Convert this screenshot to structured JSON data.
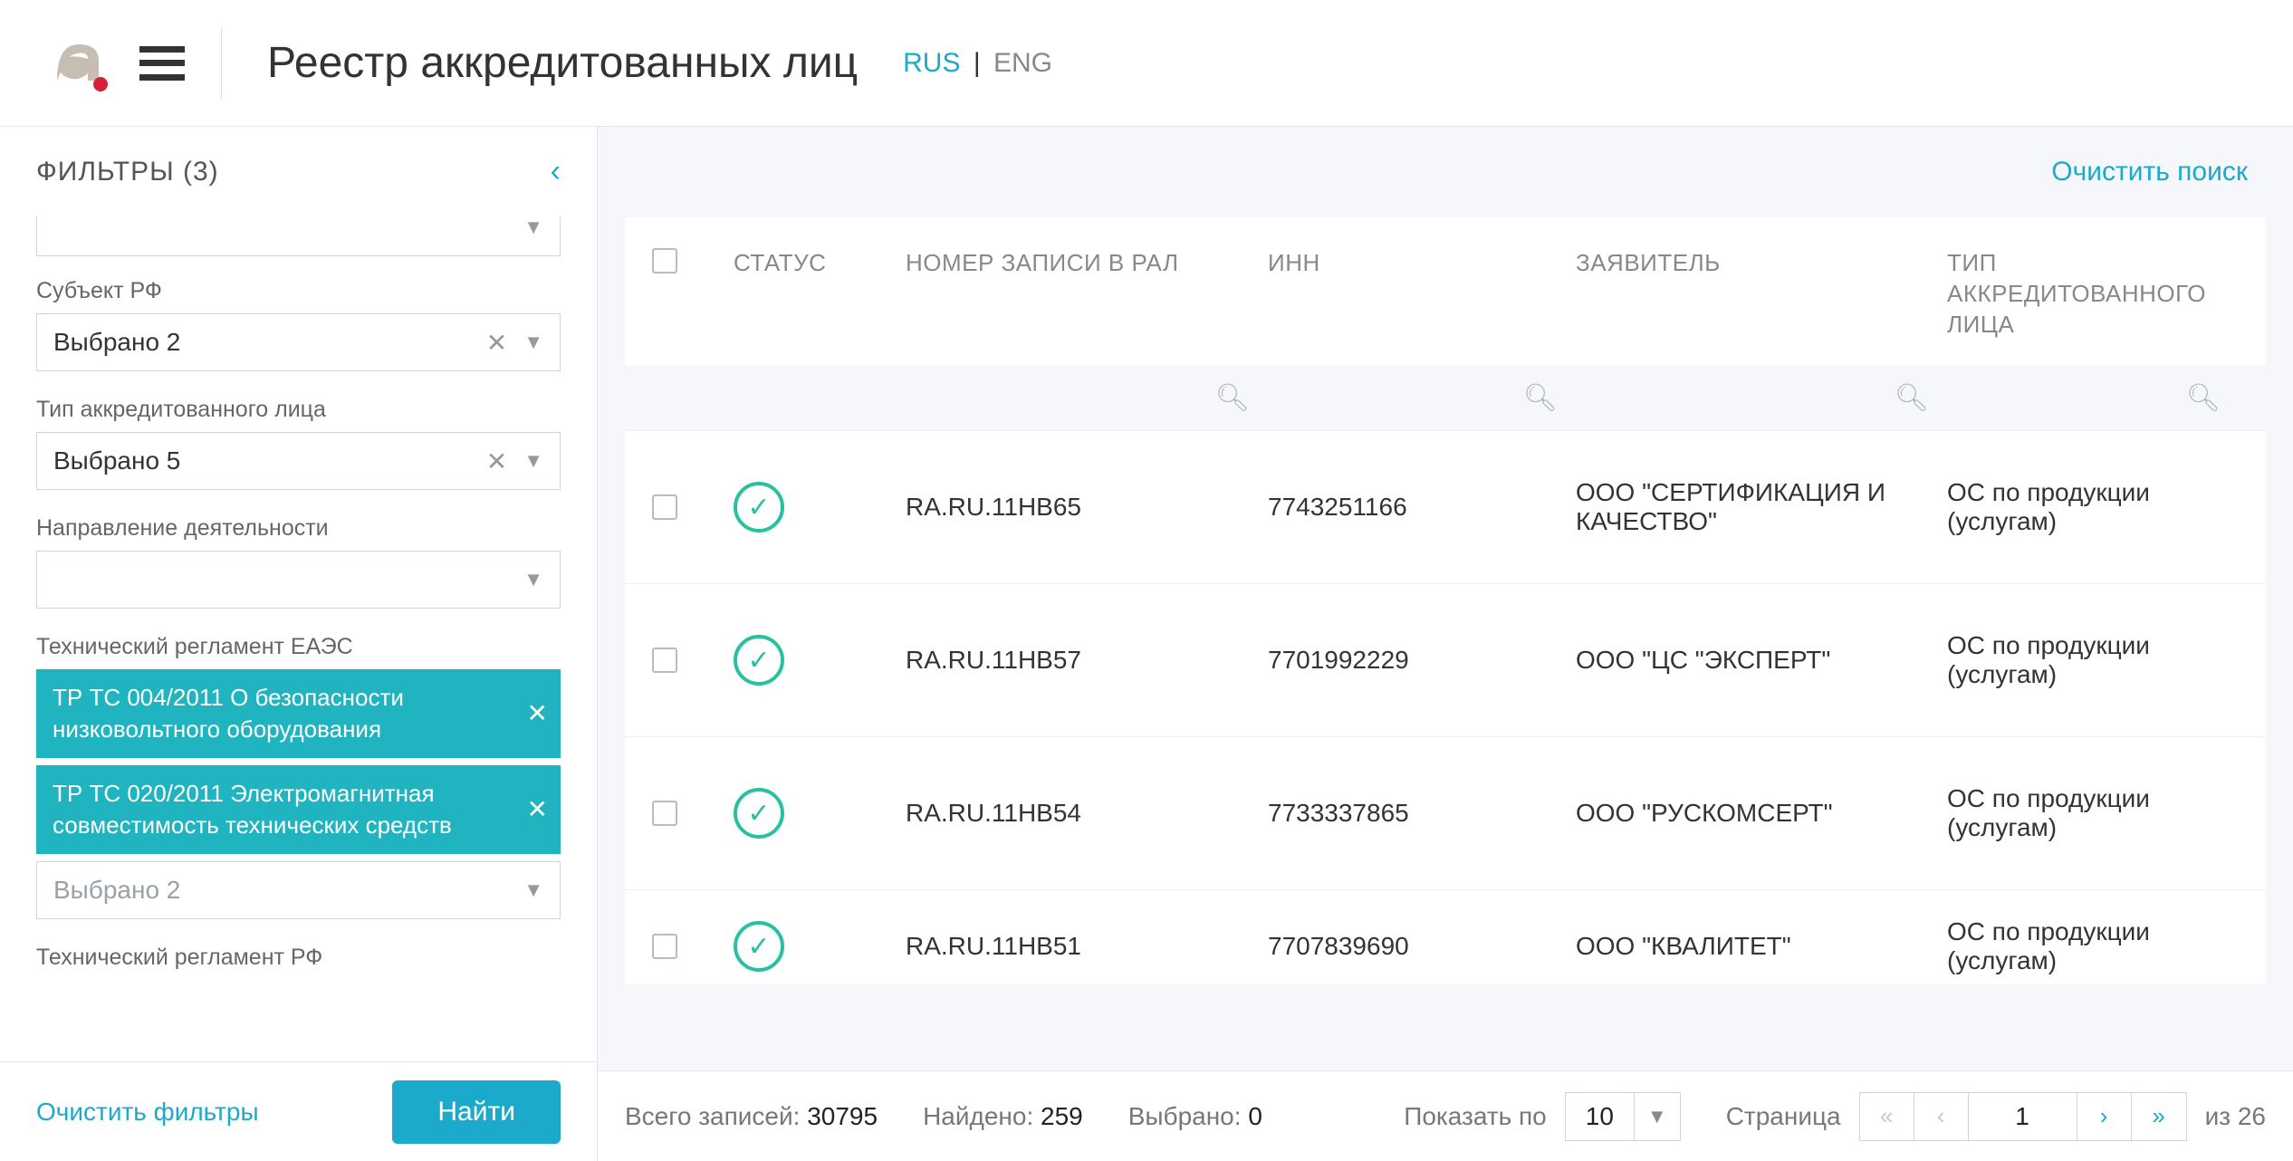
{
  "header": {
    "title": "Реестр аккредитованных лиц",
    "lang_ru": "RUS",
    "lang_en": "ENG"
  },
  "sidebar": {
    "title": "ФИЛЬТРЫ (3)",
    "clear_filters": "Очистить фильтры",
    "find": "Найти",
    "groups": {
      "subject": {
        "label": "Субъект РФ",
        "value": "Выбрано 2"
      },
      "type": {
        "label": "Тип аккредитованного лица",
        "value": "Выбрано 5"
      },
      "activity": {
        "label": "Направление деятельности",
        "value": ""
      },
      "reg_eaes": {
        "label": "Технический регламент ЕАЭС",
        "tags": [
          "ТР ТС 004/2011 О безопасности низковольтного оборудования",
          "ТР ТС 020/2011 Электромагнитная совместимость технических средств"
        ],
        "value": "Выбрано 2"
      },
      "reg_rf": {
        "label": "Технический регламент РФ"
      }
    }
  },
  "main": {
    "clear_search": "Очистить поиск",
    "columns": {
      "status": "СТАТУС",
      "record": "НОМЕР ЗАПИСИ В РАЛ",
      "inn": "ИНН",
      "applicant": "ЗАЯВИТЕЛЬ",
      "type": "ТИП АККРЕДИТОВАННОГО ЛИЦА"
    },
    "rows": [
      {
        "record": "RA.RU.11НВ65",
        "inn": "7743251166",
        "applicant": "ООО \"СЕРТИФИКАЦИЯ И КАЧЕСТВО\"",
        "type": "ОС по продукции (услугам)"
      },
      {
        "record": "RA.RU.11НВ57",
        "inn": "7701992229",
        "applicant": "ООО \"ЦС \"ЭКСПЕРТ\"",
        "type": "ОС по продукции (услугам)"
      },
      {
        "record": "RA.RU.11НВ54",
        "inn": "7733337865",
        "applicant": "ООО \"РУСКОМСЕРТ\"",
        "type": "ОС по продукции (услугам)"
      },
      {
        "record": "RA.RU.11НВ51",
        "inn": "7707839690",
        "applicant": "ООО \"КВАЛИТЕТ\"",
        "type": "ОС по продукции (услугам)"
      }
    ]
  },
  "footer": {
    "total_label": "Всего записей:",
    "total_val": "30795",
    "found_label": "Найдено:",
    "found_val": "259",
    "selected_label": "Выбрано:",
    "selected_val": "0",
    "show_label": "Показать по",
    "page_size": "10",
    "page_label": "Страница",
    "page_num": "1",
    "page_of": "из 26"
  }
}
